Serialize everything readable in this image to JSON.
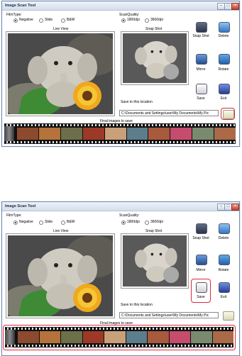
{
  "title": "Image Scan Tool",
  "film_type": {
    "label": "FilmType:",
    "options": [
      "Negative",
      "Slide",
      "B&W"
    ],
    "selected": "Negative"
  },
  "scan_quality": {
    "label": "ScanQuality:",
    "options": [
      "1800dpi",
      "3600dpi"
    ],
    "selected": "1800dpi"
  },
  "live_view_label": "Live View",
  "snapshot_label": "Snap Shot",
  "buttons": {
    "snap_shot": "Snap Shot",
    "delete": "Delete",
    "mirror": "Mirror",
    "rotate": "Rotate",
    "save": "Save",
    "exit": "Exit"
  },
  "save_location_label": "Save to this location",
  "save_path": "C:\\Documents and Settings\\user\\My Documents\\My Pic",
  "final_images_label": "Final images to save",
  "icons": {
    "window_minimize": "minimize-icon",
    "window_maximize": "maximize-icon",
    "window_close": "close-icon",
    "snap_shot": "camera-icon",
    "delete": "trash-icon",
    "mirror": "mirror-icon",
    "rotate": "rotate-icon",
    "save": "disk-icon",
    "exit": "door-icon",
    "browse": "folder-icon"
  },
  "colors": {
    "highlight": "#e0283c",
    "titlebar": "#dfe6f1",
    "film": "#111111"
  },
  "window_controls": {
    "minimize": "–",
    "maximize": "□",
    "close": "×"
  }
}
